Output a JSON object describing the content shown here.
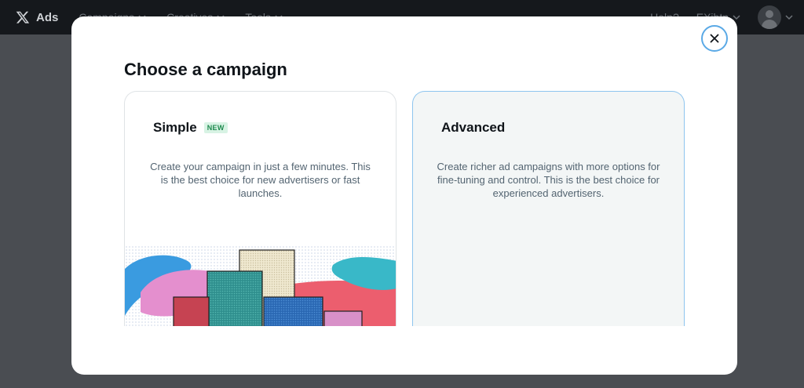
{
  "topnav": {
    "brand_label": "Ads",
    "items": [
      {
        "label": "Campaigns"
      },
      {
        "label": "Creatives"
      },
      {
        "label": "Tools"
      }
    ],
    "right_items": [
      {
        "label": "Help?"
      },
      {
        "label": "EXjbtp"
      }
    ]
  },
  "modal": {
    "title": "Choose a campaign",
    "cards": [
      {
        "title": "Simple",
        "badge": "NEW",
        "description": "Create your campaign in just a few minutes. This is the best choice for new advertisers or fast launches."
      },
      {
        "title": "Advanced",
        "description": "Create richer ad campaigns with more options for fine-tuning and control. This is the best choice for experienced advertisers."
      }
    ]
  },
  "icons": {
    "brand": "x-logo-icon",
    "close": "close-icon",
    "dropdown": "chevron-down-icon",
    "avatar": "user-avatar-icon"
  },
  "colors": {
    "overlay": "#4a4d52",
    "nav_bg": "#15181c",
    "accent": "#5aa9e6",
    "badge_bg": "#d8f3e4",
    "badge_text": "#1f8a4f",
    "advanced_bg": "#f3f6f6"
  }
}
